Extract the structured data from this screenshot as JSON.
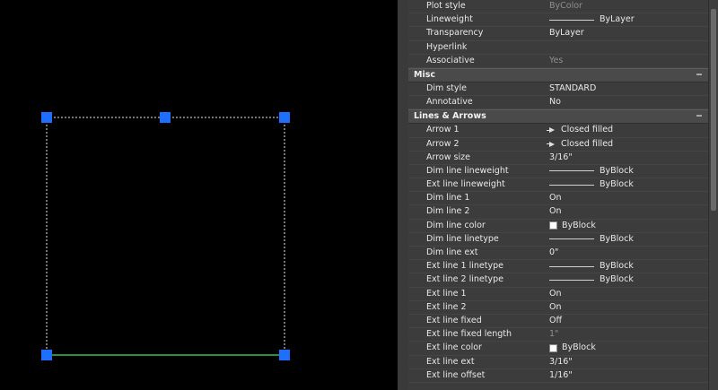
{
  "canvas": {
    "grip_color": "#1e6fff",
    "frame_color": "#e8e8e8",
    "selected_line_color": "#39c24a",
    "background": "#000000"
  },
  "properties": {
    "general": [
      {
        "label": "Plot style",
        "value": "ByColor",
        "disabled": true
      },
      {
        "label": "Lineweight",
        "value": "ByLayer",
        "lineweight": true
      },
      {
        "label": "Transparency",
        "value": "ByLayer"
      },
      {
        "label": "Hyperlink",
        "value": ""
      },
      {
        "label": "Associative",
        "value": "Yes",
        "disabled": true
      }
    ],
    "misc": {
      "title": "Misc",
      "toggle": "−",
      "rows": [
        {
          "label": "Dim style",
          "value": "STANDARD"
        },
        {
          "label": "Annotative",
          "value": "No"
        }
      ]
    },
    "lines_arrows": {
      "title": "Lines & Arrows",
      "toggle": "−",
      "rows": [
        {
          "label": "Arrow 1",
          "value": "Closed filled",
          "arrow": true
        },
        {
          "label": "Arrow 2",
          "value": "Closed filled",
          "arrow": true
        },
        {
          "label": "Arrow size",
          "value": "3/16\""
        },
        {
          "label": "Dim line lineweight",
          "value": "ByBlock",
          "lineweight": true
        },
        {
          "label": "Ext line lineweight",
          "value": "ByBlock",
          "lineweight": true
        },
        {
          "label": "Dim line 1",
          "value": "On"
        },
        {
          "label": "Dim line 2",
          "value": "On"
        },
        {
          "label": "Dim line color",
          "value": "ByBlock",
          "swatch": "#ffffff"
        },
        {
          "label": "Dim line linetype",
          "value": "ByBlock",
          "lineweight": true
        },
        {
          "label": "Dim line ext",
          "value": "0\""
        },
        {
          "label": "Ext line 1 linetype",
          "value": "ByBlock",
          "lineweight": true
        },
        {
          "label": "Ext line 2 linetype",
          "value": "ByBlock",
          "lineweight": true
        },
        {
          "label": "Ext line 1",
          "value": "On"
        },
        {
          "label": "Ext line 2",
          "value": "On"
        },
        {
          "label": "Ext line fixed",
          "value": "Off"
        },
        {
          "label": "Ext line fixed length",
          "value": "1\"",
          "disabled": true
        },
        {
          "label": "Ext line color",
          "value": "ByBlock",
          "swatch": "#ffffff"
        },
        {
          "label": "Ext line ext",
          "value": "3/16\""
        },
        {
          "label": "Ext line offset",
          "value": "1/16\""
        }
      ]
    }
  }
}
